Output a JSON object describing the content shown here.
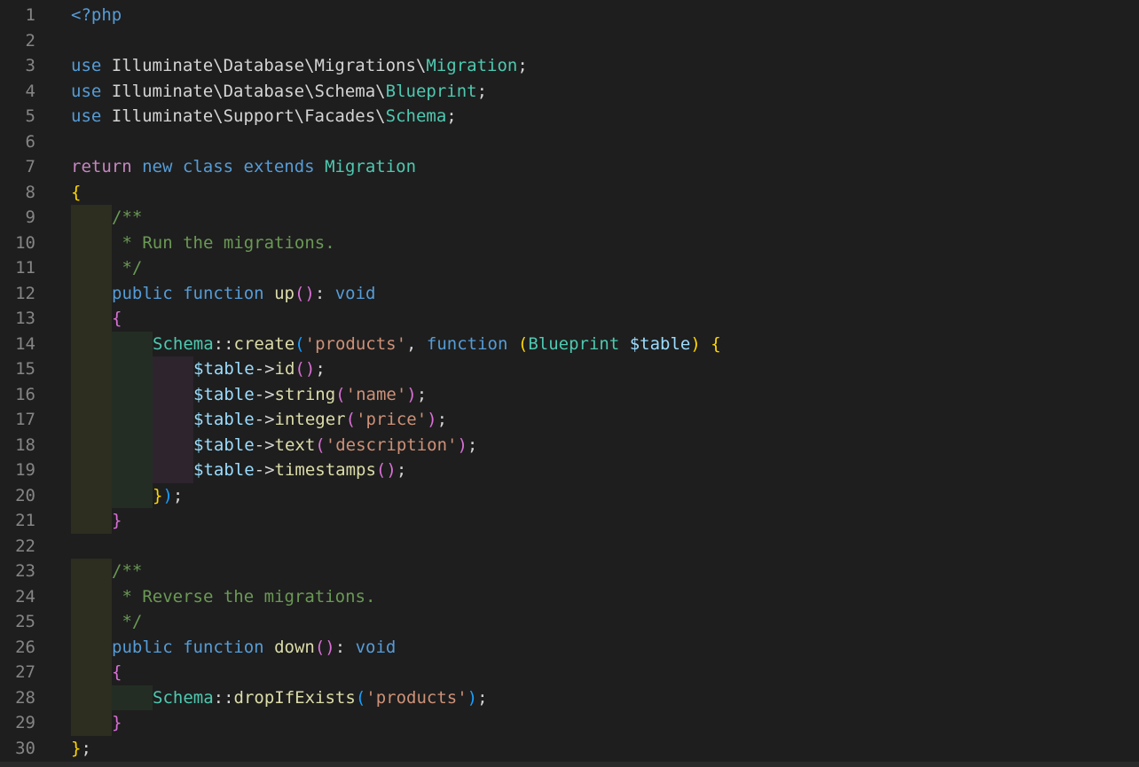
{
  "editor": {
    "language": "php",
    "lines": [
      {
        "n": "1",
        "indent": [],
        "tokens": [
          {
            "t": "<?php",
            "c": "tag"
          }
        ]
      },
      {
        "n": "2",
        "indent": [],
        "tokens": []
      },
      {
        "n": "3",
        "indent": [],
        "tokens": [
          {
            "t": "use",
            "c": "kw"
          },
          {
            "t": " Illuminate\\Database\\Migrations\\",
            "c": "ns"
          },
          {
            "t": "Migration",
            "c": "cls"
          },
          {
            "t": ";",
            "c": "op"
          }
        ]
      },
      {
        "n": "4",
        "indent": [],
        "tokens": [
          {
            "t": "use",
            "c": "kw"
          },
          {
            "t": " Illuminate\\Database\\Schema\\",
            "c": "ns"
          },
          {
            "t": "Blueprint",
            "c": "cls"
          },
          {
            "t": ";",
            "c": "op"
          }
        ]
      },
      {
        "n": "5",
        "indent": [],
        "tokens": [
          {
            "t": "use",
            "c": "kw"
          },
          {
            "t": " Illuminate\\Support\\Facades\\",
            "c": "ns"
          },
          {
            "t": "Schema",
            "c": "cls"
          },
          {
            "t": ";",
            "c": "op"
          }
        ]
      },
      {
        "n": "6",
        "indent": [],
        "tokens": []
      },
      {
        "n": "7",
        "indent": [],
        "tokens": [
          {
            "t": "return",
            "c": "ctrl"
          },
          {
            "t": " ",
            "c": "op"
          },
          {
            "t": "new",
            "c": "kw"
          },
          {
            "t": " ",
            "c": "op"
          },
          {
            "t": "class",
            "c": "kw"
          },
          {
            "t": " ",
            "c": "op"
          },
          {
            "t": "extends",
            "c": "kw"
          },
          {
            "t": " ",
            "c": "op"
          },
          {
            "t": "Migration",
            "c": "cls"
          }
        ]
      },
      {
        "n": "8",
        "indent": [],
        "tokens": [
          {
            "t": "{",
            "c": "b1"
          }
        ]
      },
      {
        "n": "9",
        "indent": [
          "ig1"
        ],
        "tokens": [
          {
            "t": "/**",
            "c": "cmt"
          }
        ]
      },
      {
        "n": "10",
        "indent": [
          "ig1"
        ],
        "tokens": [
          {
            "t": " * Run the migrations.",
            "c": "cmt"
          }
        ]
      },
      {
        "n": "11",
        "indent": [
          "ig1"
        ],
        "tokens": [
          {
            "t": " */",
            "c": "cmt"
          }
        ]
      },
      {
        "n": "12",
        "indent": [
          "ig1"
        ],
        "tokens": [
          {
            "t": "public",
            "c": "kw"
          },
          {
            "t": " ",
            "c": "op"
          },
          {
            "t": "function",
            "c": "kw"
          },
          {
            "t": " ",
            "c": "op"
          },
          {
            "t": "up",
            "c": "fn"
          },
          {
            "t": "()",
            "c": "b2"
          },
          {
            "t": ": ",
            "c": "op"
          },
          {
            "t": "void",
            "c": "kw"
          }
        ]
      },
      {
        "n": "13",
        "indent": [
          "ig1"
        ],
        "tokens": [
          {
            "t": "{",
            "c": "b2"
          }
        ]
      },
      {
        "n": "14",
        "indent": [
          "ig1",
          "ig2"
        ],
        "tokens": [
          {
            "t": "Schema",
            "c": "cls"
          },
          {
            "t": "::",
            "c": "op"
          },
          {
            "t": "create",
            "c": "fn"
          },
          {
            "t": "(",
            "c": "b3"
          },
          {
            "t": "'products'",
            "c": "str"
          },
          {
            "t": ", ",
            "c": "op"
          },
          {
            "t": "function",
            "c": "kw"
          },
          {
            "t": " ",
            "c": "op"
          },
          {
            "t": "(",
            "c": "b1"
          },
          {
            "t": "Blueprint",
            "c": "cls"
          },
          {
            "t": " ",
            "c": "op"
          },
          {
            "t": "$table",
            "c": "var"
          },
          {
            "t": ")",
            "c": "b1"
          },
          {
            "t": " ",
            "c": "op"
          },
          {
            "t": "{",
            "c": "b1"
          }
        ]
      },
      {
        "n": "15",
        "indent": [
          "ig1",
          "ig2",
          "ig3"
        ],
        "tokens": [
          {
            "t": "$table",
            "c": "var"
          },
          {
            "t": "->",
            "c": "op"
          },
          {
            "t": "id",
            "c": "fn"
          },
          {
            "t": "()",
            "c": "b2"
          },
          {
            "t": ";",
            "c": "op"
          }
        ]
      },
      {
        "n": "16",
        "indent": [
          "ig1",
          "ig2",
          "ig3"
        ],
        "tokens": [
          {
            "t": "$table",
            "c": "var"
          },
          {
            "t": "->",
            "c": "op"
          },
          {
            "t": "string",
            "c": "fn"
          },
          {
            "t": "(",
            "c": "b2"
          },
          {
            "t": "'name'",
            "c": "str"
          },
          {
            "t": ")",
            "c": "b2"
          },
          {
            "t": ";",
            "c": "op"
          }
        ]
      },
      {
        "n": "17",
        "indent": [
          "ig1",
          "ig2",
          "ig3"
        ],
        "tokens": [
          {
            "t": "$table",
            "c": "var"
          },
          {
            "t": "->",
            "c": "op"
          },
          {
            "t": "integer",
            "c": "fn"
          },
          {
            "t": "(",
            "c": "b2"
          },
          {
            "t": "'price'",
            "c": "str"
          },
          {
            "t": ")",
            "c": "b2"
          },
          {
            "t": ";",
            "c": "op"
          }
        ]
      },
      {
        "n": "18",
        "indent": [
          "ig1",
          "ig2",
          "ig3"
        ],
        "tokens": [
          {
            "t": "$table",
            "c": "var"
          },
          {
            "t": "->",
            "c": "op"
          },
          {
            "t": "text",
            "c": "fn"
          },
          {
            "t": "(",
            "c": "b2"
          },
          {
            "t": "'description'",
            "c": "str"
          },
          {
            "t": ")",
            "c": "b2"
          },
          {
            "t": ";",
            "c": "op"
          }
        ]
      },
      {
        "n": "19",
        "indent": [
          "ig1",
          "ig2",
          "ig3"
        ],
        "tokens": [
          {
            "t": "$table",
            "c": "var"
          },
          {
            "t": "->",
            "c": "op"
          },
          {
            "t": "timestamps",
            "c": "fn"
          },
          {
            "t": "()",
            "c": "b2"
          },
          {
            "t": ";",
            "c": "op"
          }
        ]
      },
      {
        "n": "20",
        "indent": [
          "ig1",
          "ig2"
        ],
        "tokens": [
          {
            "t": "}",
            "c": "b1"
          },
          {
            "t": ")",
            "c": "b3"
          },
          {
            "t": ";",
            "c": "op"
          }
        ]
      },
      {
        "n": "21",
        "indent": [
          "ig1"
        ],
        "tokens": [
          {
            "t": "}",
            "c": "b2"
          }
        ]
      },
      {
        "n": "22",
        "indent": [],
        "tokens": []
      },
      {
        "n": "23",
        "indent": [
          "ig1"
        ],
        "tokens": [
          {
            "t": "/**",
            "c": "cmt"
          }
        ]
      },
      {
        "n": "24",
        "indent": [
          "ig1"
        ],
        "tokens": [
          {
            "t": " * Reverse the migrations.",
            "c": "cmt"
          }
        ]
      },
      {
        "n": "25",
        "indent": [
          "ig1"
        ],
        "tokens": [
          {
            "t": " */",
            "c": "cmt"
          }
        ]
      },
      {
        "n": "26",
        "indent": [
          "ig1"
        ],
        "tokens": [
          {
            "t": "public",
            "c": "kw"
          },
          {
            "t": " ",
            "c": "op"
          },
          {
            "t": "function",
            "c": "kw"
          },
          {
            "t": " ",
            "c": "op"
          },
          {
            "t": "down",
            "c": "fn"
          },
          {
            "t": "()",
            "c": "b2"
          },
          {
            "t": ": ",
            "c": "op"
          },
          {
            "t": "void",
            "c": "kw"
          }
        ]
      },
      {
        "n": "27",
        "indent": [
          "ig1"
        ],
        "tokens": [
          {
            "t": "{",
            "c": "b2"
          }
        ]
      },
      {
        "n": "28",
        "indent": [
          "ig1",
          "ig2"
        ],
        "tokens": [
          {
            "t": "Schema",
            "c": "cls"
          },
          {
            "t": "::",
            "c": "op"
          },
          {
            "t": "dropIfExists",
            "c": "fn"
          },
          {
            "t": "(",
            "c": "b3"
          },
          {
            "t": "'products'",
            "c": "str"
          },
          {
            "t": ")",
            "c": "b3"
          },
          {
            "t": ";",
            "c": "op"
          }
        ]
      },
      {
        "n": "29",
        "indent": [
          "ig1"
        ],
        "tokens": [
          {
            "t": "}",
            "c": "b2"
          }
        ]
      },
      {
        "n": "30",
        "indent": [],
        "tokens": [
          {
            "t": "}",
            "c": "b1"
          },
          {
            "t": ";",
            "c": "op"
          }
        ]
      }
    ]
  },
  "colors": {
    "background": "#1e1e1e",
    "line_number": "#858585",
    "keyword": "#569cd6",
    "control": "#c586c0",
    "class": "#4ec9b0",
    "function": "#dcdcaa",
    "variable": "#9cdcfe",
    "string": "#ce9178",
    "comment": "#6a9955",
    "bracket_1": "#ffd700",
    "bracket_2": "#da70d6",
    "bracket_3": "#179fff"
  }
}
